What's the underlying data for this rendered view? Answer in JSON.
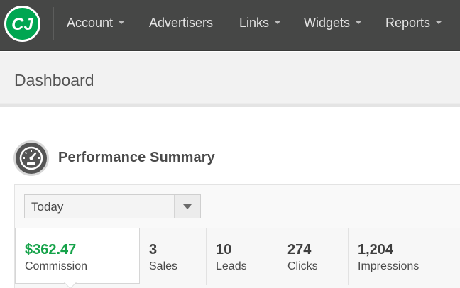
{
  "nav": {
    "logo_icon": "cj-logo-icon",
    "brand_color": "#00a651",
    "items": [
      {
        "label": "Account",
        "dropdown": true
      },
      {
        "label": "Advertisers",
        "dropdown": false
      },
      {
        "label": "Links",
        "dropdown": true
      },
      {
        "label": "Widgets",
        "dropdown": true
      },
      {
        "label": "Reports",
        "dropdown": true
      }
    ]
  },
  "page": {
    "title": "Dashboard"
  },
  "performance": {
    "icon": "speedometer-icon",
    "title": "Performance Summary",
    "period_select": {
      "value": "Today"
    },
    "metrics": [
      {
        "value": "$362.47",
        "label": "Commission",
        "active": true
      },
      {
        "value": "3",
        "label": "Sales"
      },
      {
        "value": "10",
        "label": "Leads"
      },
      {
        "value": "274",
        "label": "Clicks"
      },
      {
        "value": "1,204",
        "label": "Impressions"
      }
    ],
    "active_color": "#16a34a"
  }
}
